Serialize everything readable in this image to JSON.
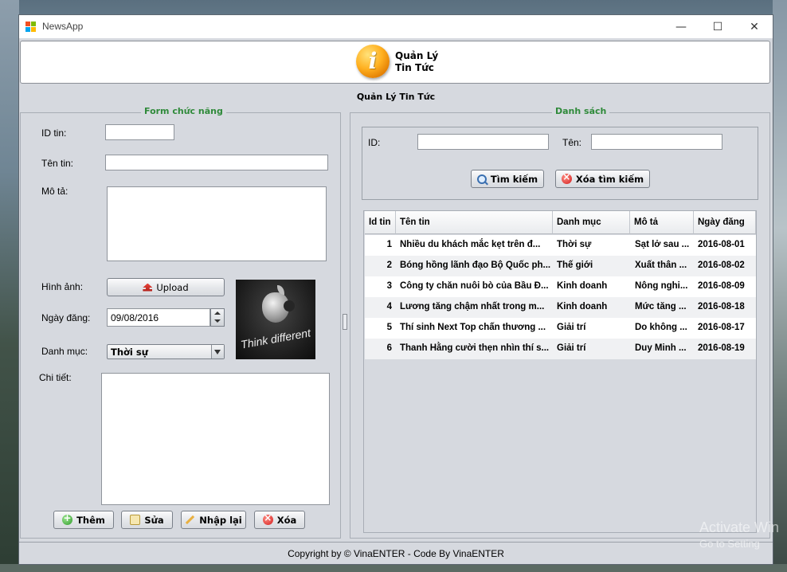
{
  "window": {
    "title": "NewsApp",
    "minimize_glyph": "—",
    "maximize_glyph": "☐",
    "close_glyph": "✕"
  },
  "header": {
    "title_line1": "Quản Lý",
    "title_line2": "Tin Tức",
    "icon": "info-icon"
  },
  "subtitle": "Quản Lý Tin Tức",
  "form": {
    "legend": "Form chức năng",
    "id_label": "ID tin:",
    "id_value": "",
    "name_label": "Tên tin:",
    "name_value": "",
    "desc_label": "Mô tả:",
    "desc_value": "",
    "image_label": "Hình ảnh:",
    "upload_label": "Upload",
    "image_caption": "Think different",
    "date_label": "Ngày đăng:",
    "date_value": "09/08/2016",
    "category_label": "Danh mục:",
    "category_value": "Thời sự",
    "detail_label": "Chi tiết:",
    "detail_value": "",
    "buttons": {
      "add": "Thêm",
      "edit": "Sửa",
      "reset": "Nhập lại",
      "delete": "Xóa"
    }
  },
  "list": {
    "legend": "Danh sách",
    "id_label": "ID:",
    "id_value": "",
    "name_label": "Tên:",
    "name_value": "",
    "search_label": "Tìm kiếm",
    "clear_label": "Xóa tìm kiếm",
    "columns": [
      "Id tin",
      "Tên tin",
      "Danh mục",
      "Mô tả",
      "Ngày đăng"
    ],
    "rows": [
      {
        "id": "1",
        "name": "Nhiều du khách mắc kẹt trên đ...",
        "category": "Thời sự",
        "desc": "Sạt lở sau ...",
        "date": "2016-08-01"
      },
      {
        "id": "2",
        "name": "Bóng hồng lãnh đạo Bộ Quốc ph...",
        "category": "Thế giới",
        "desc": "Xuất thân ...",
        "date": "2016-08-02"
      },
      {
        "id": "3",
        "name": "Công ty chăn nuôi bò của Bầu Đ...",
        "category": "Kinh doanh",
        "desc": "Nông nghi...",
        "date": "2016-08-09"
      },
      {
        "id": "4",
        "name": "Lương tăng chậm nhất trong m...",
        "category": "Kinh doanh",
        "desc": "Mức tăng ...",
        "date": "2016-08-18"
      },
      {
        "id": "5",
        "name": "Thí sinh Next Top chấn thương ...",
        "category": "Giải trí",
        "desc": "Do không ...",
        "date": "2016-08-17"
      },
      {
        "id": "6",
        "name": "Thanh Hằng cười thẹn nhìn thí s...",
        "category": "Giải trí",
        "desc": "Duy Minh ...",
        "date": "2016-08-19"
      }
    ]
  },
  "footer": "Copyright by © VinaENTER - Code By VinaENTER",
  "watermark": {
    "line1": "Activate Win",
    "line2": "Go to Setting"
  }
}
